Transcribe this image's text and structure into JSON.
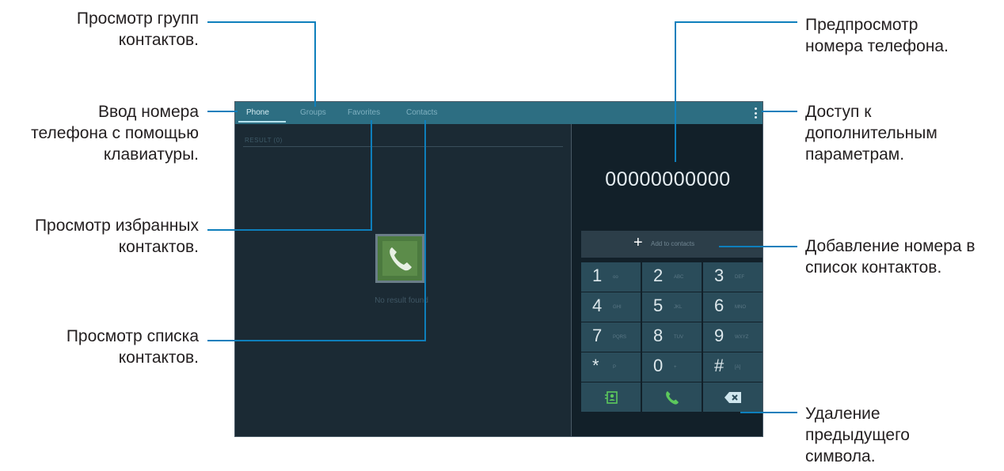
{
  "callouts": {
    "groups": [
      "Просмотр групп",
      "контактов."
    ],
    "keypad": [
      "Ввод номера",
      "телефона с помощью",
      "клавиатуры."
    ],
    "favorites": [
      "Просмотр избранных",
      "контактов."
    ],
    "contacts": [
      "Просмотр списка",
      "контактов."
    ],
    "preview": [
      "Предпросмотр",
      "номера телефона."
    ],
    "options": [
      "Доступ к",
      "дополнительным",
      "параметрам."
    ],
    "add_number": [
      "Добавление номера в",
      "список контактов."
    ],
    "delete": [
      "Удаление",
      "предыдущего",
      "символа."
    ]
  },
  "tabs": [
    {
      "label": "Phone",
      "active": true
    },
    {
      "label": "Groups",
      "active": false
    },
    {
      "label": "Favorites",
      "active": false
    },
    {
      "label": "Contacts",
      "active": false
    }
  ],
  "left_pane": {
    "section_header": "RESULT (0)",
    "empty_text": "No result found"
  },
  "dial": {
    "number": "00000000000",
    "add_to_contacts_plus": "+",
    "add_to_contacts_label": "Add to contacts"
  },
  "keypad": [
    {
      "digit": "1",
      "letters": "oo"
    },
    {
      "digit": "2",
      "letters": "ABC"
    },
    {
      "digit": "3",
      "letters": "DEF"
    },
    {
      "digit": "4",
      "letters": "GHI"
    },
    {
      "digit": "5",
      "letters": "JKL"
    },
    {
      "digit": "6",
      "letters": "MNO"
    },
    {
      "digit": "7",
      "letters": "PQRS"
    },
    {
      "digit": "8",
      "letters": "TUV"
    },
    {
      "digit": "9",
      "letters": "WXYZ"
    },
    {
      "digit": "*",
      "letters": "P"
    },
    {
      "digit": "0",
      "letters": "+"
    },
    {
      "digit": "#",
      "letters": "[A]"
    }
  ],
  "actions": {
    "contacts_icon": "add-contact-icon",
    "call_icon": "call-icon",
    "backspace_icon": "backspace-icon"
  },
  "colors": {
    "accent_line": "#0e7fbc",
    "tab_bar": "#2d6e82",
    "call_green": "#5cc85c"
  }
}
